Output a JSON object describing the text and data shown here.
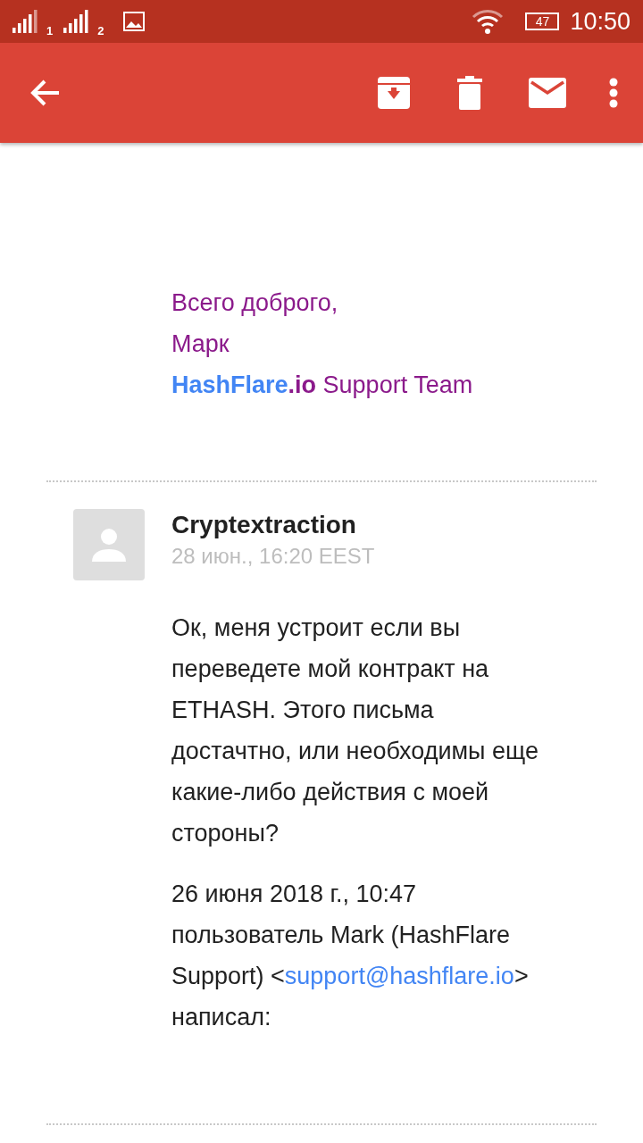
{
  "status_bar": {
    "sims": [
      "1",
      "2"
    ],
    "battery": "47",
    "time": "10:50"
  },
  "toolbar": {
    "actions": [
      {
        "kind": "archive"
      },
      {
        "kind": "delete"
      },
      {
        "kind": "mark-unread"
      },
      {
        "kind": "more"
      }
    ]
  },
  "previous_message": {
    "signature_lines": [
      "Всего доброго,",
      "Марк"
    ],
    "brand": {
      "name": "HashFlare",
      "domain": ".io",
      "tagline": "Support Team"
    }
  },
  "message": {
    "sender": "Cryptextraction",
    "date": "28 июн., 16:20 EEST",
    "body": "Ок, меня устроит если вы переведете мой контракт на ETHASH. Этого письма достачтно, или необходимы еще какие-либо действия с моей стороны?",
    "quote_header": {
      "before": "26 июня 2018 г., 10:47 пользователь Mark (HashFlare Support) <",
      "link": "support@hashflare.io",
      "after": "> написал:"
    }
  }
}
